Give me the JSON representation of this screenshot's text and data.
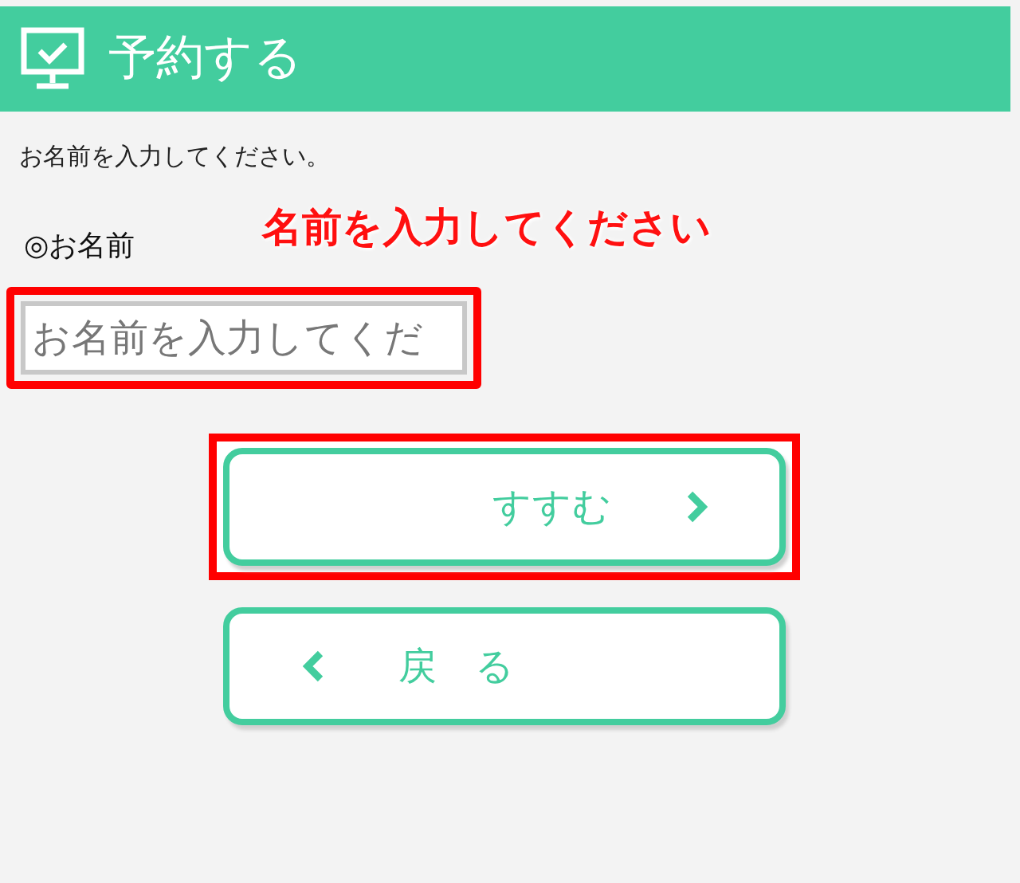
{
  "header": {
    "title": "予約する"
  },
  "instruction": "お名前を入力してください。",
  "callout": "名前を入力してください",
  "field": {
    "label": "◎お名前",
    "placeholder": "お名前を入力してくだ",
    "highlighted": true
  },
  "buttons": [
    {
      "label": "すすむ",
      "kind": "next",
      "highlighted": true
    },
    {
      "label": "戻　る",
      "kind": "back",
      "highlighted": false
    }
  ]
}
